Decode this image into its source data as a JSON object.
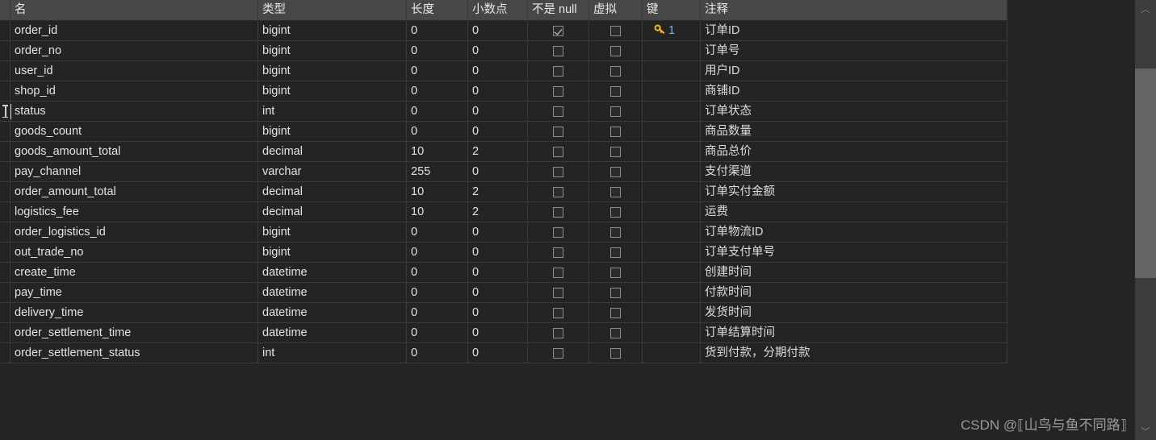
{
  "table": {
    "columns": [
      {
        "key": "name",
        "label": "名"
      },
      {
        "key": "type",
        "label": "类型"
      },
      {
        "key": "length",
        "label": "长度"
      },
      {
        "key": "decimal",
        "label": "小数点"
      },
      {
        "key": "notnull",
        "label": "不是 null"
      },
      {
        "key": "virtual",
        "label": "虚拟"
      },
      {
        "key": "keycol",
        "label": "键"
      },
      {
        "key": "comment",
        "label": "注释"
      }
    ],
    "rows": [
      {
        "name": "order_id",
        "type": "bigint",
        "length": "0",
        "decimal": "0",
        "notnull": true,
        "virtual": false,
        "key": "1",
        "comment": "订单ID"
      },
      {
        "name": "order_no",
        "type": "bigint",
        "length": "0",
        "decimal": "0",
        "notnull": false,
        "virtual": false,
        "key": "",
        "comment": "订单号"
      },
      {
        "name": "user_id",
        "type": "bigint",
        "length": "0",
        "decimal": "0",
        "notnull": false,
        "virtual": false,
        "key": "",
        "comment": "用户ID"
      },
      {
        "name": "shop_id",
        "type": "bigint",
        "length": "0",
        "decimal": "0",
        "notnull": false,
        "virtual": false,
        "key": "",
        "comment": "商铺ID"
      },
      {
        "name": "status",
        "type": "int",
        "length": "0",
        "decimal": "0",
        "notnull": false,
        "virtual": false,
        "key": "",
        "comment": "订单状态"
      },
      {
        "name": "goods_count",
        "type": "bigint",
        "length": "0",
        "decimal": "0",
        "notnull": false,
        "virtual": false,
        "key": "",
        "comment": "商品数量"
      },
      {
        "name": "goods_amount_total",
        "type": "decimal",
        "length": "10",
        "decimal": "2",
        "notnull": false,
        "virtual": false,
        "key": "",
        "comment": "商品总价"
      },
      {
        "name": "pay_channel",
        "type": "varchar",
        "length": "255",
        "decimal": "0",
        "notnull": false,
        "virtual": false,
        "key": "",
        "comment": "支付渠道"
      },
      {
        "name": "order_amount_total",
        "type": "decimal",
        "length": "10",
        "decimal": "2",
        "notnull": false,
        "virtual": false,
        "key": "",
        "comment": "订单实付金额"
      },
      {
        "name": "logistics_fee",
        "type": "decimal",
        "length": "10",
        "decimal": "2",
        "notnull": false,
        "virtual": false,
        "key": "",
        "comment": "运费"
      },
      {
        "name": "order_logistics_id",
        "type": "bigint",
        "length": "0",
        "decimal": "0",
        "notnull": false,
        "virtual": false,
        "key": "",
        "comment": "订单物流ID"
      },
      {
        "name": "out_trade_no",
        "type": "bigint",
        "length": "0",
        "decimal": "0",
        "notnull": false,
        "virtual": false,
        "key": "",
        "comment": "订单支付单号"
      },
      {
        "name": "create_time",
        "type": "datetime",
        "length": "0",
        "decimal": "0",
        "notnull": false,
        "virtual": false,
        "key": "",
        "comment": "创建时间"
      },
      {
        "name": "pay_time",
        "type": "datetime",
        "length": "0",
        "decimal": "0",
        "notnull": false,
        "virtual": false,
        "key": "",
        "comment": "付款时间"
      },
      {
        "name": "delivery_time",
        "type": "datetime",
        "length": "0",
        "decimal": "0",
        "notnull": false,
        "virtual": false,
        "key": "",
        "comment": "发货时间"
      },
      {
        "name": "order_settlement_time",
        "type": "datetime",
        "length": "0",
        "decimal": "0",
        "notnull": false,
        "virtual": false,
        "key": "",
        "comment": "订单结算时间"
      },
      {
        "name": "order_settlement_status",
        "type": "int",
        "length": "0",
        "decimal": "0",
        "notnull": false,
        "virtual": false,
        "key": "",
        "comment": "货到付款，分期付款"
      }
    ],
    "cursor_row_index": 4,
    "icons": {
      "primary_key": "key-icon",
      "scroll_up": "chevron-up-icon",
      "scroll_down": "chevron-down-icon"
    }
  },
  "scrollbar": {
    "up_arrow": "︿",
    "down_arrow": "﹀"
  },
  "watermark": {
    "text": "CSDN @⟦山鸟与鱼不同路⟧"
  },
  "colors": {
    "header_bg": "#474747",
    "row_bg": "#242424",
    "grid_line": "#3a3a3a",
    "text": "#dcdcdc",
    "key_icon": "#f0b41e",
    "key_number": "#7fb2e5",
    "scrollbar_track": "#3c3c3c",
    "scrollbar_thumb": "#646464"
  }
}
